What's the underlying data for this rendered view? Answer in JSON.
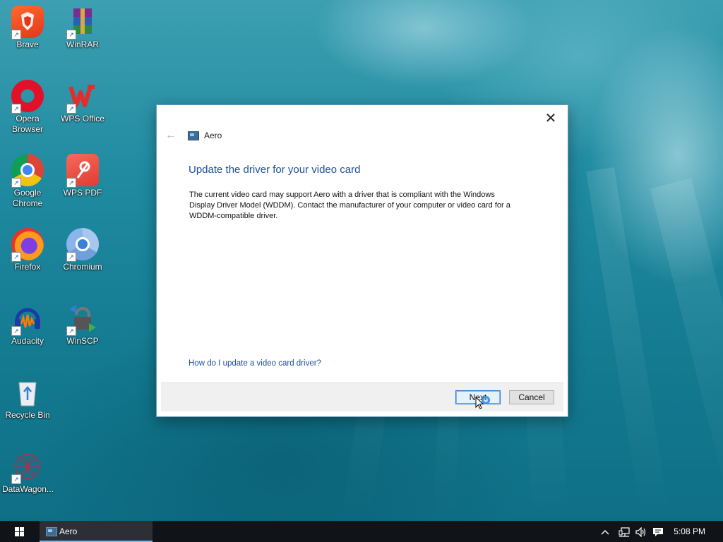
{
  "desktop": {
    "icons": [
      {
        "label": "Brave",
        "icon": "brave-icon"
      },
      {
        "label": "WinRAR",
        "icon": "winrar-icon"
      },
      {
        "label": "Opera Browser",
        "icon": "opera-icon"
      },
      {
        "label": "WPS Office",
        "icon": "wps-office-icon"
      },
      {
        "label": "Google Chrome",
        "icon": "chrome-icon"
      },
      {
        "label": "WPS PDF",
        "icon": "wps-pdf-icon"
      },
      {
        "label": "Firefox",
        "icon": "firefox-icon"
      },
      {
        "label": "Chromium",
        "icon": "chromium-icon"
      },
      {
        "label": "Audacity",
        "icon": "audacity-icon"
      },
      {
        "label": "WinSCP",
        "icon": "winscp-icon"
      },
      {
        "label": "Recycle Bin",
        "icon": "recycle-bin-icon"
      },
      {
        "label": "DataWagon...",
        "icon": "datawagon-icon"
      }
    ]
  },
  "dialog": {
    "app_title": "Aero",
    "heading": "Update the driver for your video card",
    "body_line1": "The current video card may support Aero with a driver that is compliant with the Windows",
    "body_line2": "Display Driver Model (WDDM).  Contact the manufacturer of your computer or video card for a",
    "body_line3": "WDDM-compatible driver.",
    "help_link": "How do I update a video card driver?",
    "next_label": "Next",
    "cancel_label": "Cancel",
    "close_glyph": "✕",
    "back_glyph": "←"
  },
  "taskbar": {
    "active_app": "Aero",
    "clock": "5:08 PM",
    "tray_icons": [
      "chevron-up-icon",
      "network-icon",
      "volume-icon",
      "action-center-icon"
    ]
  },
  "colors": {
    "heading": "#1d4f9a",
    "link": "#1f4ea1",
    "taskbar": "#101317",
    "accent": "#76b9ed"
  }
}
